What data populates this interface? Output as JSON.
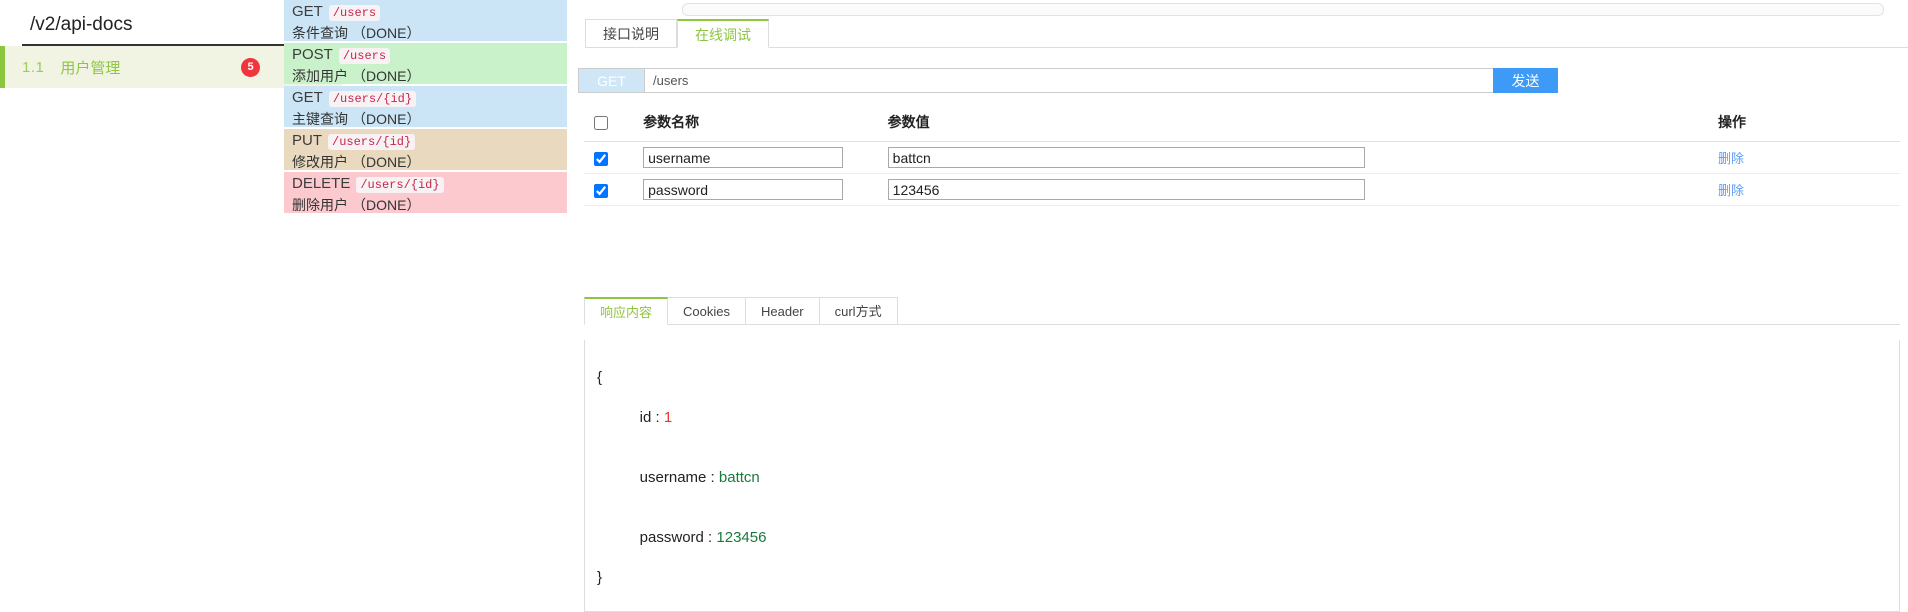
{
  "left": {
    "doc_select": {
      "value": "/v2/api-docs",
      "caret_icon": "chevron-down-icon"
    },
    "menu_group": {
      "index": "1.1",
      "label": "用户管理",
      "badge": "5"
    }
  },
  "api_list": [
    {
      "method": "GET",
      "path": "/users",
      "summary": "条件查询",
      "status": "（DONE）",
      "type": "get"
    },
    {
      "method": "POST",
      "path": "/users",
      "summary": "添加用户",
      "status": "（DONE）",
      "type": "post"
    },
    {
      "method": "GET",
      "path": "/users/{id}",
      "summary": "主键查询",
      "status": "（DONE）",
      "type": "get"
    },
    {
      "method": "PUT",
      "path": "/users/{id}",
      "summary": "修改用户",
      "status": "（DONE）",
      "type": "put"
    },
    {
      "method": "DELETE",
      "path": "/users/{id}",
      "summary": "删除用户",
      "status": "（DONE）",
      "type": "delete"
    }
  ],
  "top_tabs": [
    {
      "label": "接口说明",
      "active": false
    },
    {
      "label": "在线调试",
      "active": true
    }
  ],
  "request": {
    "method": "GET",
    "url": "/users",
    "url_placeholder": "",
    "send_label": "发送"
  },
  "params": {
    "headers": {
      "select_all": "",
      "name": "参数名称",
      "value": "参数值",
      "op": "操作"
    },
    "rows": [
      {
        "checked": true,
        "name": "username",
        "value": "battcn",
        "delete_label": "删除"
      },
      {
        "checked": true,
        "name": "password",
        "value": "123456",
        "delete_label": "删除"
      }
    ]
  },
  "response_tabs": [
    {
      "label": "响应内容",
      "active": true
    },
    {
      "label": "Cookies",
      "active": false
    },
    {
      "label": "Header",
      "active": false
    },
    {
      "label": "curl方式",
      "active": false
    }
  ],
  "response_body": {
    "open_brace": "{",
    "close_brace": "}",
    "fields": [
      {
        "key": "id",
        "colon": " : ",
        "value": "1",
        "value_type": "num"
      },
      {
        "key": "username",
        "colon": " : ",
        "value": "battcn",
        "value_type": "str"
      },
      {
        "key": "password",
        "colon": " : ",
        "value": "123456",
        "value_type": "str"
      }
    ]
  },
  "colors": {
    "accent_green": "#8dc63f",
    "send_blue": "#3d9bf7",
    "badge_red": "#f0353f",
    "get_bg": "#cce5f6",
    "post_bg": "#caf2ca",
    "put_bg": "#e8d9bf",
    "delete_bg": "#fbc9ce",
    "path_text": "#c7254e",
    "link_blue": "#5b9bf8",
    "json_num": "#e8372a",
    "json_str": "#1a7a3c"
  }
}
